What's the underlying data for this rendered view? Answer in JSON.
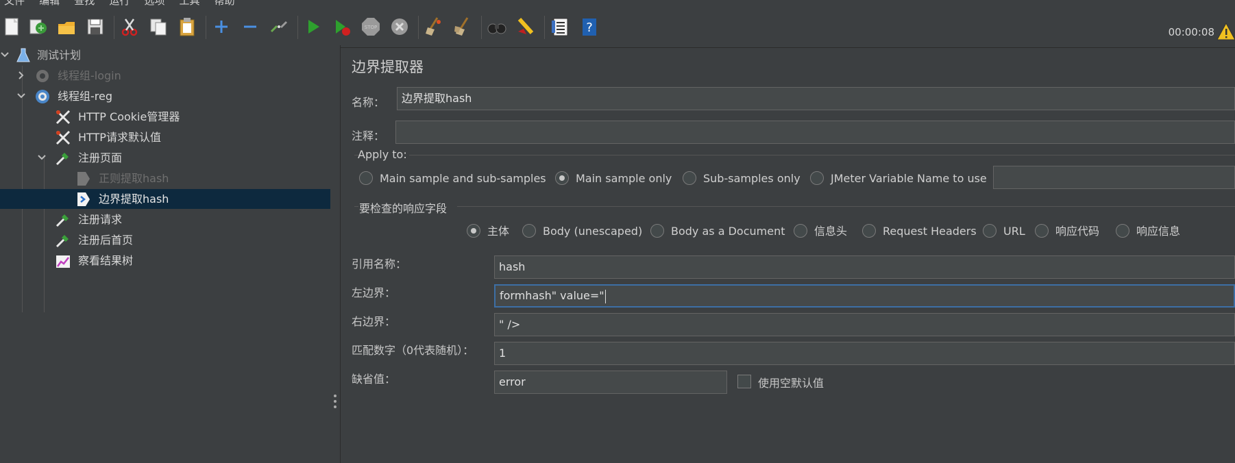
{
  "menu": [
    "文件",
    "编辑",
    "查找",
    "运行",
    "选项",
    "工具",
    "帮助"
  ],
  "toolbar": {
    "icons": [
      "new-icon",
      "templates-icon",
      "open-icon",
      "save-icon",
      "cut-icon",
      "copy-icon",
      "paste-icon",
      "expand-icon",
      "collapse-icon",
      "toggle-icon",
      "start-icon",
      "start-no-pause-icon",
      "stop-icon",
      "shutdown-icon",
      "clear-icon",
      "clear-all-icon",
      "search-icon",
      "reset-search-icon",
      "function-helper-icon",
      "help-icon"
    ],
    "timer": "00:00:08"
  },
  "tree": {
    "nodes": [
      {
        "label": "测试计划",
        "icon": "flask-icon",
        "state": "normal"
      },
      {
        "label": "线程组-login",
        "icon": "gear-icon",
        "state": "disabled"
      },
      {
        "label": "线程组-reg",
        "icon": "gear-icon",
        "state": "normal"
      },
      {
        "label": "HTTP Cookie管理器",
        "icon": "tools-icon",
        "state": "normal"
      },
      {
        "label": "HTTP请求默认值",
        "icon": "tools-icon",
        "state": "normal"
      },
      {
        "label": "注册页面",
        "icon": "pipette-icon",
        "state": "normal"
      },
      {
        "label": "正则提取hash",
        "icon": "extractor-icon",
        "state": "disabled"
      },
      {
        "label": "边界提取hash",
        "icon": "extractor-icon",
        "state": "selected"
      },
      {
        "label": "注册请求",
        "icon": "pipette-icon",
        "state": "normal"
      },
      {
        "label": "注册后首页",
        "icon": "pipette-icon",
        "state": "normal"
      },
      {
        "label": "察看结果树",
        "icon": "graph-icon",
        "state": "normal"
      }
    ]
  },
  "panel": {
    "title": "边界提取器",
    "name_label": "名称：",
    "name_value": "边界提取hash",
    "comment_label": "注释：",
    "comment_value": "",
    "apply_to": {
      "label": "Apply to:",
      "options": [
        "Main sample and sub-samples",
        "Main sample only",
        "Sub-samples only",
        "JMeter Variable Name to use"
      ],
      "selected": 1,
      "variable_value": ""
    },
    "response_field": {
      "label": "要检查的响应字段",
      "options": [
        "主体",
        "Body (unescaped)",
        "Body as a Document",
        "信息头",
        "Request Headers",
        "URL",
        "响应代码",
        "响应信息"
      ],
      "selected": 0
    },
    "ref_name_label": "引用名称：",
    "ref_name_value": "hash",
    "left_boundary_label": "左边界：",
    "left_boundary_value": "formhash\" value=\"",
    "right_boundary_label": "右边界：",
    "right_boundary_value": "\" />",
    "match_no_label": "匹配数字（0代表随机）：",
    "match_no_value": "1",
    "default_label": "缺省值：",
    "default_value": "error",
    "use_empty_default_label": "使用空默认值",
    "use_empty_default_checked": false
  }
}
